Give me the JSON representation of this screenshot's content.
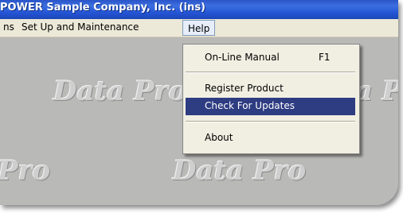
{
  "window": {
    "title": "POWER Sample Company, Inc. (ins)"
  },
  "menubar": {
    "items": [
      {
        "label": "ns"
      },
      {
        "label": "Set Up and Maintenance"
      },
      {
        "label": "Help",
        "open": true
      }
    ]
  },
  "help_menu": {
    "items": [
      {
        "label": "On-Line Manual",
        "shortcut": "F1"
      },
      {
        "label": "Register Product"
      },
      {
        "label": "Check For Updates",
        "selected": true
      },
      {
        "label": "About"
      }
    ]
  },
  "watermark": {
    "text": "Data Pro",
    "fragment_right": "a P",
    "fragment_left": "Pro"
  },
  "colors": {
    "titlebar": "#2556d6",
    "menu_background": "#f1efe2",
    "selection": "#2e3c82",
    "desktop": "#b9b9b7"
  }
}
